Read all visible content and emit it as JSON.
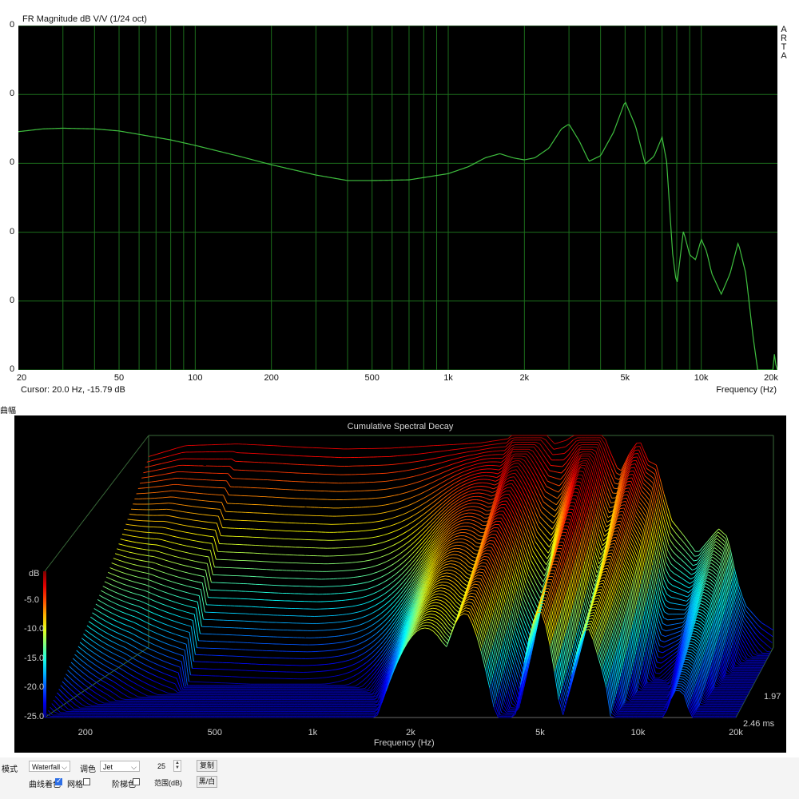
{
  "top_chart": {
    "title": "FR Magnitude dB V/V (1/24 oct)",
    "cursor": "Cursor: 20.0 Hz, -15.79 dB",
    "legend_letters": [
      "A",
      "R",
      "T",
      "A"
    ]
  },
  "section_label": "曲幅",
  "bottom_chart": {
    "time_axis_labels": [
      "1.97",
      "2.46 ms"
    ]
  },
  "controls": {
    "mode_label": "模式",
    "mode_value": "Waterfall",
    "palette_label": "调色",
    "palette_value": "Jet",
    "range_value": "25",
    "copy_button": "复制",
    "curve_color_label": "曲线着色",
    "curve_color_checked": true,
    "grid_label": "网格",
    "grid_checked": false,
    "step_color_label": "阶梯色",
    "step_color_checked": false,
    "range_label": "范围(dB)",
    "bw_button": "黑/白"
  },
  "colors": {
    "fr_trace": "#3fbf3f",
    "grid": "#1c6e1c",
    "plot_bg": "#000000"
  },
  "chart_data": [
    {
      "type": "line",
      "title": "FR Magnitude dB V/V (1/24 oct)",
      "xlabel": "Frequency (Hz)",
      "ylabel": "",
      "xscale": "log",
      "xlim": [
        20,
        20000
      ],
      "ylim": [
        -50,
        0
      ],
      "x_ticks": [
        20,
        50,
        100,
        200,
        500,
        1000,
        2000,
        5000,
        10000,
        20000
      ],
      "x_tick_labels": [
        "20",
        "50",
        "100",
        "200",
        "500",
        "1k",
        "2k",
        "5k",
        "10k",
        "20k"
      ],
      "y_ticks": [
        0,
        -10,
        -20,
        -30,
        -40,
        -50
      ],
      "y_tick_labels": [
        "0",
        "0",
        "0",
        "0",
        "0",
        "0"
      ],
      "grid": true,
      "series": [
        {
          "name": "",
          "x": [
            20,
            25,
            30,
            40,
            50,
            60,
            80,
            100,
            150,
            200,
            300,
            400,
            500,
            700,
            1000,
            1200,
            1400,
            1600,
            1800,
            2000,
            2200,
            2500,
            2800,
            3000,
            3300,
            3600,
            4000,
            4500,
            5000,
            5500,
            6000,
            6500,
            7000,
            7300,
            7700,
            8000,
            8500,
            9000,
            9500,
            10000,
            10500,
            11000,
            12000,
            13000,
            14000,
            15000,
            16000,
            17000,
            18000,
            19000,
            19500,
            20000
          ],
          "y": [
            -15.4,
            -15.0,
            -14.9,
            -15.0,
            -15.3,
            -15.8,
            -16.6,
            -17.4,
            -19.0,
            -20.2,
            -21.7,
            -22.5,
            -22.5,
            -22.4,
            -21.5,
            -20.5,
            -19.2,
            -18.6,
            -19.2,
            -19.5,
            -19.2,
            -17.8,
            -15.0,
            -14.3,
            -16.8,
            -19.7,
            -18.9,
            -15.5,
            -11.0,
            -14.6,
            -20.1,
            -19.0,
            -16.2,
            -19.8,
            -33.0,
            -37.8,
            -29.8,
            -33.3,
            -34.0,
            -31.0,
            -32.8,
            -36.0,
            -39.0,
            -36.0,
            -31.5,
            -36.0,
            -45.0,
            -52.0,
            -54.0,
            -55.0,
            -47.0,
            -52.0
          ]
        }
      ]
    },
    {
      "type": "area",
      "title": "Cumulative Spectral Decay",
      "xlabel": "Frequency (Hz)",
      "ylabel": "dB",
      "xscale": "log",
      "xlim": [
        150,
        20000
      ],
      "x_ticks": [
        200,
        500,
        1000,
        2000,
        5000,
        10000,
        20000
      ],
      "x_tick_labels": [
        "200",
        "500",
        "1k",
        "2k",
        "5k",
        "10k",
        "20k"
      ],
      "zlim": [
        -25,
        0
      ],
      "z_ticks": [
        -5,
        -10,
        -15,
        -20,
        -25
      ],
      "z_tick_labels": [
        "-5.0",
        "-10.0",
        "-15.0",
        "-20.0",
        "-25.0"
      ],
      "time_ticks": [
        1.97,
        2.46
      ],
      "time_unit": "ms",
      "colormap": "Jet",
      "slices": 60,
      "base_response": {
        "x": [
          150,
          200,
          300,
          400,
          500,
          700,
          1000,
          1400,
          2000,
          2500,
          2800,
          3000,
          3300,
          3600,
          4000,
          5000,
          5500,
          6000,
          6500,
          7000,
          7500,
          8000,
          8500,
          9000,
          10000,
          11000,
          13000,
          14000,
          15000,
          16000,
          18000,
          20000
        ],
        "y": [
          -2.5,
          -1.2,
          -1.0,
          -1.2,
          -1.4,
          -1.6,
          -1.5,
          -1.2,
          -0.9,
          -0.4,
          1.5,
          2.0,
          0.5,
          -1.0,
          -0.5,
          2.5,
          -1.5,
          -4.5,
          -2.0,
          -0.5,
          -3.0,
          -3.5,
          -7.0,
          -10.0,
          -12.0,
          -14.0,
          -11.0,
          -12.0,
          -17.0,
          -20.0,
          -22.0,
          -23.0
        ]
      }
    }
  ]
}
